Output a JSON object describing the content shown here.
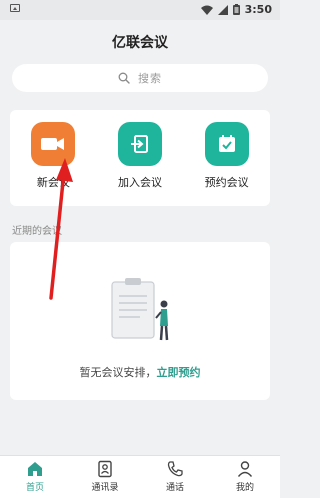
{
  "status_bar": {
    "time": "3:50"
  },
  "header": {
    "title": "亿联会议"
  },
  "search": {
    "placeholder": "搜索"
  },
  "actions": [
    {
      "label": "新会议",
      "icon": "video-camera-icon",
      "color": "#f07f35"
    },
    {
      "label": "加入会议",
      "icon": "join-icon",
      "color": "#1fb49c"
    },
    {
      "label": "预约会议",
      "icon": "calendar-check-icon",
      "color": "#1fb49c"
    }
  ],
  "recent": {
    "title": "近期的会议",
    "empty_text": "暂无会议安排，",
    "empty_link": "立即预约"
  },
  "nav": [
    {
      "label": "首页",
      "icon": "home-icon",
      "active": true
    },
    {
      "label": "通讯录",
      "icon": "contacts-icon",
      "active": false
    },
    {
      "label": "通话",
      "icon": "phone-icon",
      "active": false
    },
    {
      "label": "我的",
      "icon": "person-icon",
      "active": false
    }
  ],
  "colors": {
    "accent": "#2f9e8f",
    "orange": "#f07f35",
    "teal": "#1fb49c",
    "arrow": "#e02020"
  }
}
